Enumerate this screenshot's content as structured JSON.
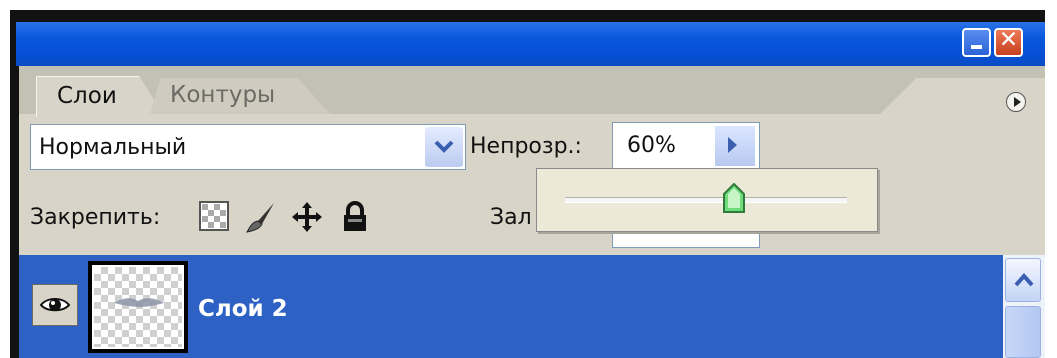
{
  "window": {
    "title": ""
  },
  "tabs": [
    {
      "label": "Слои",
      "active": true
    },
    {
      "label": "Контуры",
      "active": false
    }
  ],
  "blend_mode": {
    "value": "Нормальный"
  },
  "opacity": {
    "label": "Непрозр.:",
    "value": "60%",
    "slider_fraction": 0.6
  },
  "lock": {
    "label": "Закрепить:",
    "icons": [
      "lock-transparency-icon",
      "lock-image-icon",
      "lock-position-icon",
      "lock-all-icon"
    ]
  },
  "fill": {
    "label": "Зал"
  },
  "layers": [
    {
      "name": "Слой 2",
      "visible": true,
      "selected": true
    }
  ],
  "colors": {
    "titlebar": "#0a58dc",
    "selection": "#2e61c4",
    "panel": "#d8d5c8"
  }
}
